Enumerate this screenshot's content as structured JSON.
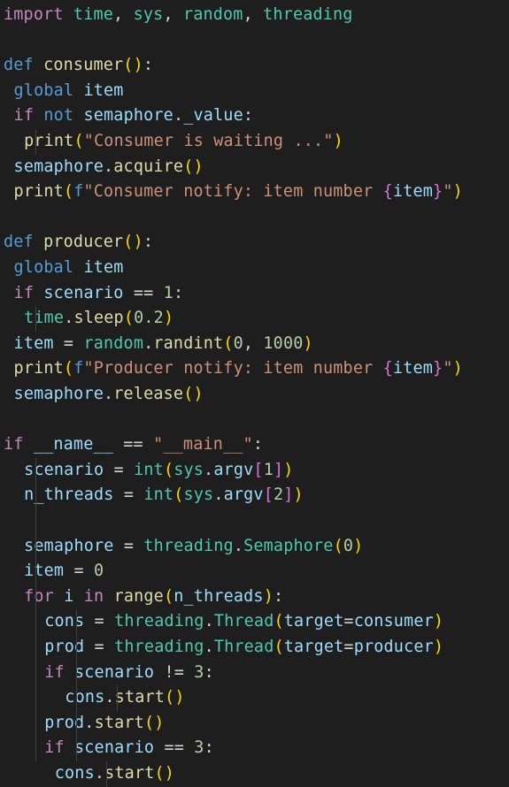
{
  "editor": {
    "background": "#1e1e1e",
    "language": "python",
    "lines": [
      {
        "indent": 0,
        "tokens": [
          [
            "import",
            "ctrl"
          ],
          [
            " ",
            "op"
          ],
          [
            "time",
            "mod"
          ],
          [
            ", ",
            "op"
          ],
          [
            "sys",
            "mod"
          ],
          [
            ", ",
            "op"
          ],
          [
            "random",
            "mod"
          ],
          [
            ", ",
            "op"
          ],
          [
            "threading",
            "mod"
          ]
        ]
      },
      {
        "indent": 0,
        "tokens": []
      },
      {
        "indent": 0,
        "tokens": [
          [
            "def",
            "kw"
          ],
          [
            " ",
            "op"
          ],
          [
            "consumer",
            "fn"
          ],
          [
            "()",
            "br1"
          ],
          [
            ":",
            "op"
          ]
        ]
      },
      {
        "indent": 1,
        "tokens": [
          [
            "global",
            "kw"
          ],
          [
            " ",
            "op"
          ],
          [
            "item",
            "var"
          ]
        ]
      },
      {
        "indent": 1,
        "tokens": [
          [
            "if",
            "ctrl"
          ],
          [
            " ",
            "op"
          ],
          [
            "not",
            "kw"
          ],
          [
            " ",
            "op"
          ],
          [
            "semaphore",
            "var"
          ],
          [
            ".",
            "op"
          ],
          [
            "_value",
            "var"
          ],
          [
            ":",
            "op"
          ]
        ]
      },
      {
        "indent": 2,
        "tokens": [
          [
            "print",
            "fn"
          ],
          [
            "(",
            "br1"
          ],
          [
            "\"Consumer is waiting ...\"",
            "str"
          ],
          [
            ")",
            "br1"
          ]
        ]
      },
      {
        "indent": 1,
        "tokens": [
          [
            "semaphore",
            "var"
          ],
          [
            ".",
            "op"
          ],
          [
            "acquire",
            "fn"
          ],
          [
            "()",
            "br1"
          ]
        ]
      },
      {
        "indent": 1,
        "tokens": [
          [
            "print",
            "fn"
          ],
          [
            "(",
            "br1"
          ],
          [
            "f",
            "kw"
          ],
          [
            "\"Consumer notify: item number ",
            "str"
          ],
          [
            "{",
            "br2"
          ],
          [
            "item",
            "var"
          ],
          [
            "}",
            "br2"
          ],
          [
            "\"",
            "str"
          ],
          [
            ")",
            "br1"
          ]
        ]
      },
      {
        "indent": 0,
        "tokens": []
      },
      {
        "indent": 0,
        "tokens": [
          [
            "def",
            "kw"
          ],
          [
            " ",
            "op"
          ],
          [
            "producer",
            "fn"
          ],
          [
            "()",
            "br1"
          ],
          [
            ":",
            "op"
          ]
        ]
      },
      {
        "indent": 1,
        "tokens": [
          [
            "global",
            "kw"
          ],
          [
            " ",
            "op"
          ],
          [
            "item",
            "var"
          ]
        ]
      },
      {
        "indent": 1,
        "tokens": [
          [
            "if",
            "ctrl"
          ],
          [
            " ",
            "op"
          ],
          [
            "scenario",
            "var"
          ],
          [
            " == ",
            "op"
          ],
          [
            "1",
            "num"
          ],
          [
            ":",
            "op"
          ]
        ]
      },
      {
        "indent": 2,
        "tokens": [
          [
            "time",
            "mod"
          ],
          [
            ".",
            "op"
          ],
          [
            "sleep",
            "fn"
          ],
          [
            "(",
            "br1"
          ],
          [
            "0.2",
            "num"
          ],
          [
            ")",
            "br1"
          ]
        ]
      },
      {
        "indent": 1,
        "tokens": [
          [
            "item",
            "var"
          ],
          [
            " = ",
            "op"
          ],
          [
            "random",
            "mod"
          ],
          [
            ".",
            "op"
          ],
          [
            "randint",
            "fn"
          ],
          [
            "(",
            "br1"
          ],
          [
            "0",
            "num"
          ],
          [
            ", ",
            "op"
          ],
          [
            "1000",
            "num"
          ],
          [
            ")",
            "br1"
          ]
        ]
      },
      {
        "indent": 1,
        "tokens": [
          [
            "print",
            "fn"
          ],
          [
            "(",
            "br1"
          ],
          [
            "f",
            "kw"
          ],
          [
            "\"Producer notify: item number ",
            "str"
          ],
          [
            "{",
            "br2"
          ],
          [
            "item",
            "var"
          ],
          [
            "}",
            "br2"
          ],
          [
            "\"",
            "str"
          ],
          [
            ")",
            "br1"
          ]
        ]
      },
      {
        "indent": 1,
        "tokens": [
          [
            "semaphore",
            "var"
          ],
          [
            ".",
            "op"
          ],
          [
            "release",
            "fn"
          ],
          [
            "()",
            "br1"
          ]
        ]
      },
      {
        "indent": 0,
        "tokens": []
      },
      {
        "indent": 0,
        "tokens": [
          [
            "if",
            "ctrl"
          ],
          [
            " ",
            "op"
          ],
          [
            "__name__",
            "var"
          ],
          [
            " == ",
            "op"
          ],
          [
            "\"__main__\"",
            "str"
          ],
          [
            ":",
            "op"
          ]
        ]
      },
      {
        "indent": 2,
        "tokens": [
          [
            "scenario",
            "var"
          ],
          [
            " = ",
            "op"
          ],
          [
            "int",
            "mod"
          ],
          [
            "(",
            "br1"
          ],
          [
            "sys",
            "mod"
          ],
          [
            ".",
            "op"
          ],
          [
            "argv",
            "var"
          ],
          [
            "[",
            "br2"
          ],
          [
            "1",
            "num"
          ],
          [
            "]",
            "br2"
          ],
          [
            ")",
            "br1"
          ]
        ]
      },
      {
        "indent": 2,
        "tokens": [
          [
            "n_threads",
            "var"
          ],
          [
            " = ",
            "op"
          ],
          [
            "int",
            "mod"
          ],
          [
            "(",
            "br1"
          ],
          [
            "sys",
            "mod"
          ],
          [
            ".",
            "op"
          ],
          [
            "argv",
            "var"
          ],
          [
            "[",
            "br2"
          ],
          [
            "2",
            "num"
          ],
          [
            "]",
            "br2"
          ],
          [
            ")",
            "br1"
          ]
        ]
      },
      {
        "indent": 0,
        "tokens": []
      },
      {
        "indent": 2,
        "tokens": [
          [
            "semaphore",
            "var"
          ],
          [
            " = ",
            "op"
          ],
          [
            "threading",
            "mod"
          ],
          [
            ".",
            "op"
          ],
          [
            "Semaphore",
            "mod"
          ],
          [
            "(",
            "br1"
          ],
          [
            "0",
            "num"
          ],
          [
            ")",
            "br1"
          ]
        ]
      },
      {
        "indent": 2,
        "tokens": [
          [
            "item",
            "var"
          ],
          [
            " = ",
            "op"
          ],
          [
            "0",
            "num"
          ]
        ]
      },
      {
        "indent": 2,
        "tokens": [
          [
            "for",
            "ctrl"
          ],
          [
            " ",
            "op"
          ],
          [
            "i",
            "var"
          ],
          [
            " ",
            "op"
          ],
          [
            "in",
            "ctrl"
          ],
          [
            " ",
            "op"
          ],
          [
            "range",
            "fn"
          ],
          [
            "(",
            "br1"
          ],
          [
            "n_threads",
            "var"
          ],
          [
            ")",
            "br1"
          ],
          [
            ":",
            "op"
          ]
        ]
      },
      {
        "indent": 4,
        "tokens": [
          [
            "cons",
            "var"
          ],
          [
            " = ",
            "op"
          ],
          [
            "threading",
            "mod"
          ],
          [
            ".",
            "op"
          ],
          [
            "Thread",
            "mod"
          ],
          [
            "(",
            "br1"
          ],
          [
            "target",
            "var"
          ],
          [
            "=",
            "op"
          ],
          [
            "consumer",
            "var"
          ],
          [
            ")",
            "br1"
          ]
        ]
      },
      {
        "indent": 4,
        "tokens": [
          [
            "prod",
            "var"
          ],
          [
            " = ",
            "op"
          ],
          [
            "threading",
            "mod"
          ],
          [
            ".",
            "op"
          ],
          [
            "Thread",
            "mod"
          ],
          [
            "(",
            "br1"
          ],
          [
            "target",
            "var"
          ],
          [
            "=",
            "op"
          ],
          [
            "producer",
            "var"
          ],
          [
            ")",
            "br1"
          ]
        ]
      },
      {
        "indent": 4,
        "tokens": [
          [
            "if",
            "ctrl"
          ],
          [
            " ",
            "op"
          ],
          [
            "scenario",
            "var"
          ],
          [
            " != ",
            "op"
          ],
          [
            "3",
            "num"
          ],
          [
            ":",
            "op"
          ]
        ]
      },
      {
        "indent": 6,
        "tokens": [
          [
            "cons",
            "var"
          ],
          [
            ".",
            "op"
          ],
          [
            "start",
            "fn"
          ],
          [
            "()",
            "br1"
          ]
        ]
      },
      {
        "indent": 4,
        "tokens": [
          [
            "prod",
            "var"
          ],
          [
            ".",
            "op"
          ],
          [
            "start",
            "fn"
          ],
          [
            "()",
            "br1"
          ]
        ]
      },
      {
        "indent": 4,
        "tokens": [
          [
            "if",
            "ctrl"
          ],
          [
            " ",
            "op"
          ],
          [
            "scenario",
            "var"
          ],
          [
            " == ",
            "op"
          ],
          [
            "3",
            "num"
          ],
          [
            ":",
            "op"
          ]
        ]
      },
      {
        "indent": 5,
        "tokens": [
          [
            "cons",
            "var"
          ],
          [
            ".",
            "op"
          ],
          [
            "start",
            "fn"
          ],
          [
            "()",
            "br1"
          ]
        ]
      }
    ]
  }
}
